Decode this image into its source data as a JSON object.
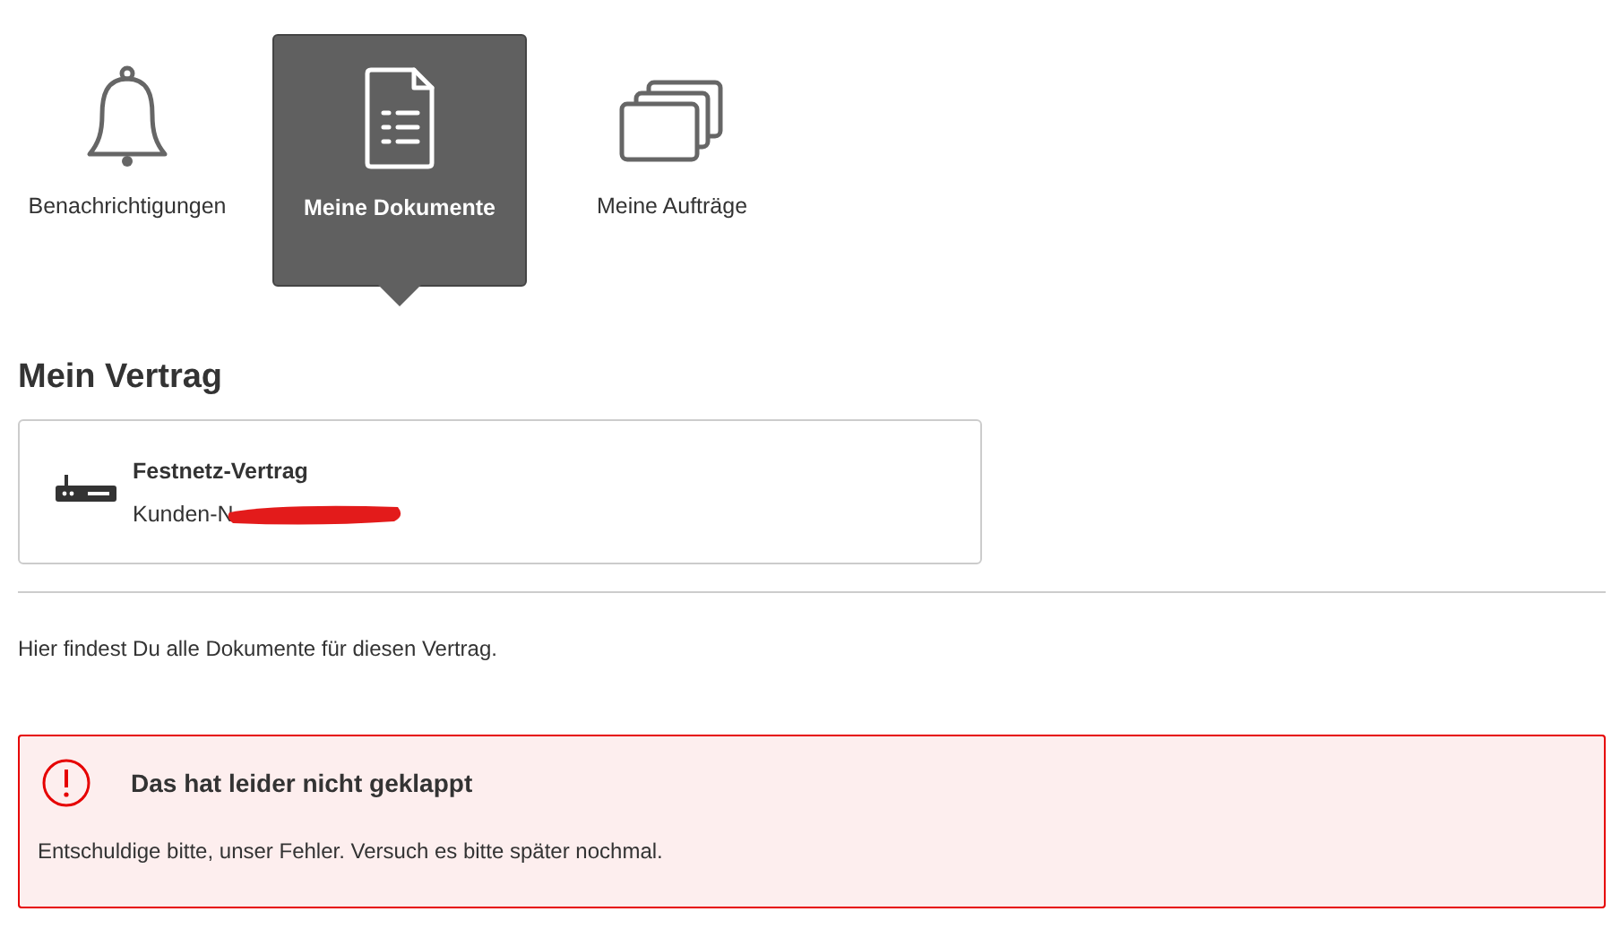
{
  "tabs": [
    {
      "label": "Benachrichtigungen",
      "kind": "bell",
      "selected": false
    },
    {
      "label": "Meine Dokumente",
      "kind": "document",
      "selected": true
    },
    {
      "label": "Meine Aufträge",
      "kind": "stack",
      "selected": false
    }
  ],
  "contract": {
    "heading": "Mein Vertrag",
    "title": "Festnetz-Vertrag",
    "customer_number": "Kunden-N",
    "redacted": true
  },
  "intro": "Hier findest Du alle Dokumente für diesen Vertrag.",
  "error": {
    "title": "Das hat leider nicht geklappt",
    "message": "Entschuldige bitte, unser Fehler. Versuch es bitte später nochmal."
  }
}
